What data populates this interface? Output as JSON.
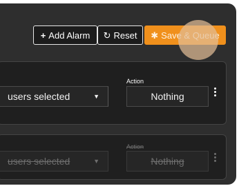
{
  "toolbar": {
    "add_alarm_label": "Add Alarm",
    "reset_label": "Reset",
    "save_queue_label": "Save & Queue",
    "save_queue_color": "#f0901c"
  },
  "rows": [
    {
      "users_text": "users selected",
      "action_label": "Action",
      "action_value": "Nothing",
      "disabled": false
    },
    {
      "users_text": "users selected",
      "action_label": "Action",
      "action_value": "Nothing",
      "disabled": true
    }
  ],
  "icons": {
    "add": "plus-icon",
    "reset": "reset-icon",
    "save": "gear-icon",
    "dropdown": "caret-down-icon",
    "menu": "kebab-menu-icon"
  }
}
